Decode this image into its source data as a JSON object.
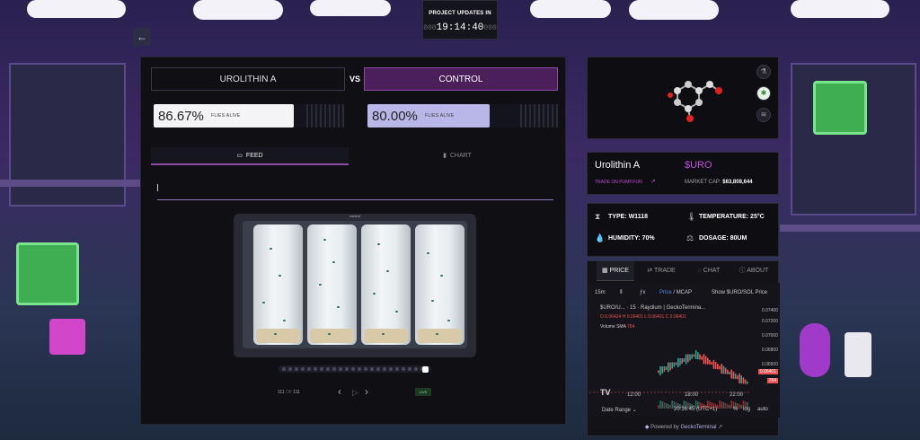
{
  "header": {
    "title": "PROJECT UPDATES IN",
    "countdown": "19:14:40",
    "countdown_pad_left": "000",
    "countdown_pad_right": "000"
  },
  "comparison": {
    "left_label": "UROLITHIN A",
    "vs": "VS",
    "right_label": "CONTROL",
    "left_percent": "86.67%",
    "left_percent_value": 86.67,
    "right_percent": "80.00%",
    "right_percent_value": 80.0,
    "survival_label": "FLIES ALIVE"
  },
  "tabs": {
    "feed": "FEED",
    "chart": "CHART"
  },
  "video": {
    "caption": "control",
    "counter_current": "111",
    "counter_sep": "OF",
    "counter_total": "111",
    "live": "LIVE"
  },
  "token": {
    "name": "Urolithin A",
    "ticker": "$URO",
    "trade_link": "TRADE ON PUMP.FUN",
    "market_cap_label": "MARKET CAP:",
    "market_cap_value": "$63,808,644"
  },
  "conditions": {
    "type_label": "TYPE:",
    "type_value": "W1118",
    "temp_label": "TEMPERATURE:",
    "temp_value": "25°C",
    "humidity_label": "HUMIDITY:",
    "humidity_value": "70%",
    "dosage_label": "DOSAGE:",
    "dosage_value": "80UM"
  },
  "widget": {
    "tabs": [
      "PRICE",
      "TRADE",
      "CHAT",
      "ABOUT"
    ],
    "interval": "15m",
    "price_toggle": "Price",
    "mcap_toggle": "MCAP",
    "show_pair": "Show $URO/SOL Price",
    "pair_title": "$URO/U... · 15 · Raydium | GeckoTermina...",
    "ohlc_o": "O 0.06424",
    "ohlc_h": "H 0.06401",
    "ohlc_l": "L 0.06401",
    "ohlc_c": "C 0.06401",
    "volume_label": "Volume SMA",
    "volume_value": "784",
    "yaxis": [
      "0.07400",
      "0.07200",
      "0.07000",
      "0.06800",
      "0.06600",
      "0.06401",
      "784"
    ],
    "xaxis": [
      "12:00",
      "18:00",
      "22:00"
    ],
    "date_range": "Date Range",
    "time": "20:16:45 (UTC+1)",
    "percent_btn": "%",
    "log_btn": "log",
    "auto_btn": "auto",
    "powered_by": "Powered by",
    "powered_brand": "GeckoTerminal"
  },
  "colors": {
    "accent": "#8c4aa6",
    "ticker": "#c24fd9",
    "bar_left": "#f4f4f6",
    "bar_right": "#b9b6e8",
    "up": "#26a69a",
    "down": "#ef5350"
  }
}
